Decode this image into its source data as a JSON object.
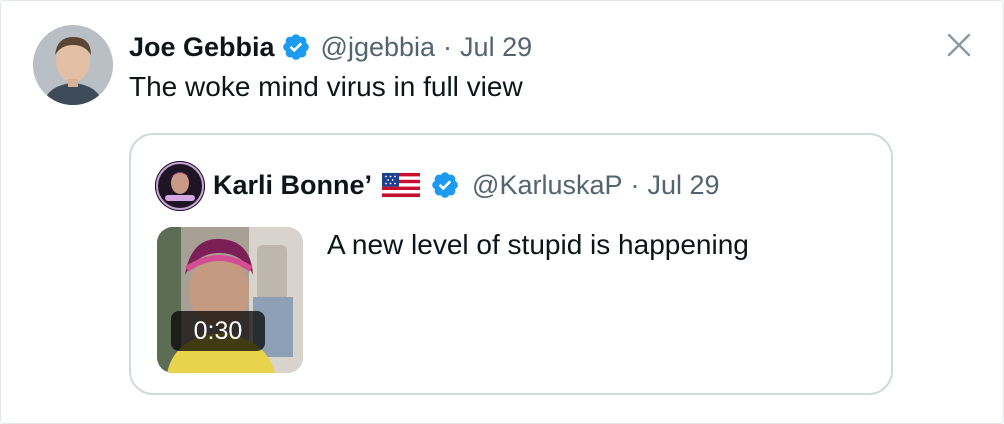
{
  "tweet": {
    "author_name": "Joe Gebbia",
    "author_handle": "@jgebbia",
    "separator": "·",
    "date": "Jul 29",
    "text": "The woke mind virus in full view",
    "verified_icon": "verified-badge-icon",
    "avatar_icon": "avatar"
  },
  "close": {
    "icon": "close-icon",
    "glyph": "✕"
  },
  "quoted_tweet": {
    "author_name": "Karli Bonne’",
    "flag_icon": "us-flag-icon",
    "verified_icon": "verified-badge-icon",
    "author_handle": "@KarluskaP",
    "separator": "·",
    "date": "Jul 29",
    "text": "A new level of stupid is happening",
    "media": {
      "type": "video-thumbnail",
      "duration": "0:30"
    }
  },
  "colors": {
    "verified_blue": "#1d9bf0",
    "text_primary": "#0f1419",
    "text_secondary": "#536471",
    "border": "#cfd9de"
  }
}
